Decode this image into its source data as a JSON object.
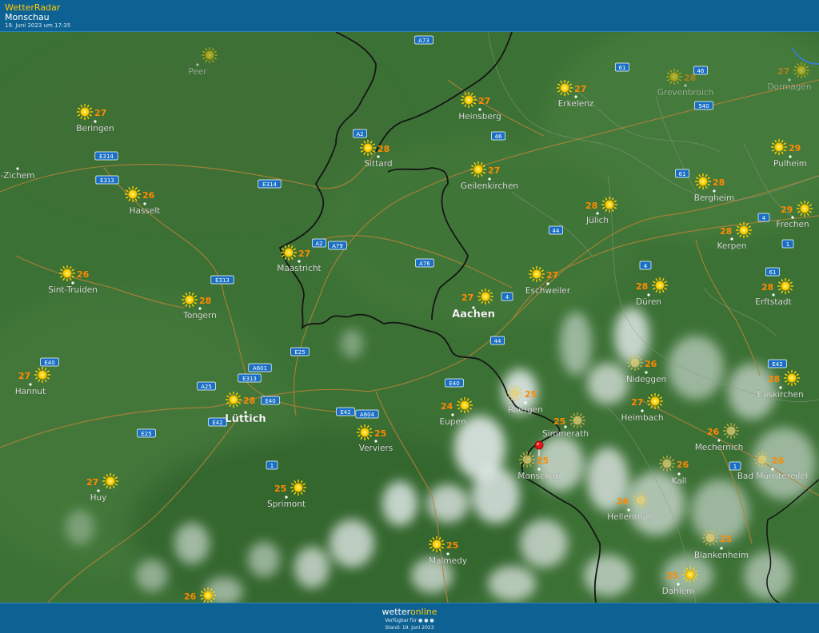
{
  "header": {
    "app_name": "WetterRadar",
    "location": "Monschau",
    "timestamp": "19. Juni 2023 um 17:35"
  },
  "footer": {
    "brand_part1": "wetter",
    "brand_part2": "online",
    "availability": "Verfügbar für",
    "stand": "Stand: 19. Juni 2023"
  },
  "colors": {
    "sun": "#ffd400",
    "temp": "#ff8a00",
    "city_label": "#ffffff",
    "road_badge": "#1a6fc4",
    "border": "#111111",
    "header_bg": "#0e6293"
  },
  "cities": [
    {
      "name": "Peer",
      "temp": "",
      "faded": true,
      "icon": "sun-icon"
    },
    {
      "name": "Beringen",
      "temp": "27",
      "icon": "sun-icon"
    },
    {
      "name": "-Zichem",
      "temp": "",
      "icon": "none"
    },
    {
      "name": "Hasselt",
      "temp": "26",
      "icon": "sun-icon"
    },
    {
      "name": "Sint-Truiden",
      "temp": "26",
      "icon": "sun-icon"
    },
    {
      "name": "Tongern",
      "temp": "28",
      "icon": "sun-icon"
    },
    {
      "name": "Hannut",
      "temp": "27",
      "icon": "sun-icon"
    },
    {
      "name": "Huy",
      "temp": "27",
      "icon": "sun-icon"
    },
    {
      "name": "Lüttich",
      "temp": "28",
      "big": true,
      "icon": "sun-icon"
    },
    {
      "name": "Sprimont",
      "temp": "25",
      "icon": "sun-icon"
    },
    {
      "name": "Maastricht",
      "temp": "27",
      "icon": "sun-icon"
    },
    {
      "name": "Sittard",
      "temp": "28",
      "icon": "sun-icon"
    },
    {
      "name": "Heinsberg",
      "temp": "27",
      "icon": "sun-icon"
    },
    {
      "name": "Geilenkirchen",
      "temp": "27",
      "icon": "sun-icon"
    },
    {
      "name": "Erkelenz",
      "temp": "27",
      "icon": "sun-icon"
    },
    {
      "name": "Grevenbroich",
      "temp": "28",
      "faded": true,
      "icon": "sun-icon"
    },
    {
      "name": "Dormagen",
      "temp": "27",
      "faded": true,
      "icon": "sun-icon"
    },
    {
      "name": "Pulheim",
      "temp": "29",
      "icon": "sun-icon"
    },
    {
      "name": "Bergheim",
      "temp": "28",
      "icon": "sun-icon"
    },
    {
      "name": "Frechen",
      "temp": "29",
      "icon": "sun-icon"
    },
    {
      "name": "Jülich",
      "temp": "28",
      "icon": "sun-icon"
    },
    {
      "name": "Kerpen",
      "temp": "28",
      "icon": "sun-icon"
    },
    {
      "name": "Eschweiler",
      "temp": "27",
      "icon": "sun-icon"
    },
    {
      "name": "Düren",
      "temp": "28",
      "icon": "sun-icon"
    },
    {
      "name": "Erftstadt",
      "temp": "28",
      "icon": "sun-icon"
    },
    {
      "name": "Aachen",
      "temp": "27",
      "big": true,
      "icon": "sun-icon"
    },
    {
      "name": "Verviers",
      "temp": "25",
      "icon": "sun-icon"
    },
    {
      "name": "Eupen",
      "temp": "24",
      "icon": "sun-icon"
    },
    {
      "name": "Roetgen",
      "temp": "25",
      "icon": "sun-cloud-icon"
    },
    {
      "name": "Simmerath",
      "temp": "25",
      "icon": "sun-cloud-icon"
    },
    {
      "name": "Monschau",
      "temp": "25",
      "icon": "sun-cloud-icon"
    },
    {
      "name": "Nideggen",
      "temp": "26",
      "icon": "sun-cloud-icon"
    },
    {
      "name": "Heimbach",
      "temp": "27",
      "icon": "sun-icon"
    },
    {
      "name": "Euskirchen",
      "temp": "28",
      "icon": "sun-icon"
    },
    {
      "name": "Mechernich",
      "temp": "26",
      "icon": "sun-cloud-icon"
    },
    {
      "name": "Kall",
      "temp": "26",
      "icon": "sun-cloud-icon"
    },
    {
      "name": "Bad Münstereifel",
      "temp": "26",
      "icon": "sun-cloud-icon"
    },
    {
      "name": "Hellenthal",
      "temp": "26",
      "icon": "sun-cloud-icon"
    },
    {
      "name": "Blankenheim",
      "temp": "25",
      "icon": "sun-cloud-icon"
    },
    {
      "name": "Malmedy",
      "temp": "25",
      "icon": "sun-icon"
    },
    {
      "name": "Dahlem",
      "temp": "25",
      "icon": "sun-icon"
    },
    {
      "name": "",
      "temp": "26",
      "icon": "sun-icon"
    }
  ],
  "roads": [
    "A73",
    "61",
    "46",
    "A2",
    "46",
    "540",
    "E314",
    "E313",
    "E314",
    "A2",
    "A79",
    "61",
    "4",
    "A76",
    "44",
    "4",
    "1",
    "4",
    "61",
    "E313",
    "E40",
    "A601",
    "E25",
    "E313",
    "A25",
    "E40",
    "44",
    "E40",
    "E42",
    "A604",
    "E42",
    "E25",
    "1",
    "E42",
    "1"
  ],
  "marker": {
    "name": "Monschau",
    "icon": "location-pin-icon"
  }
}
